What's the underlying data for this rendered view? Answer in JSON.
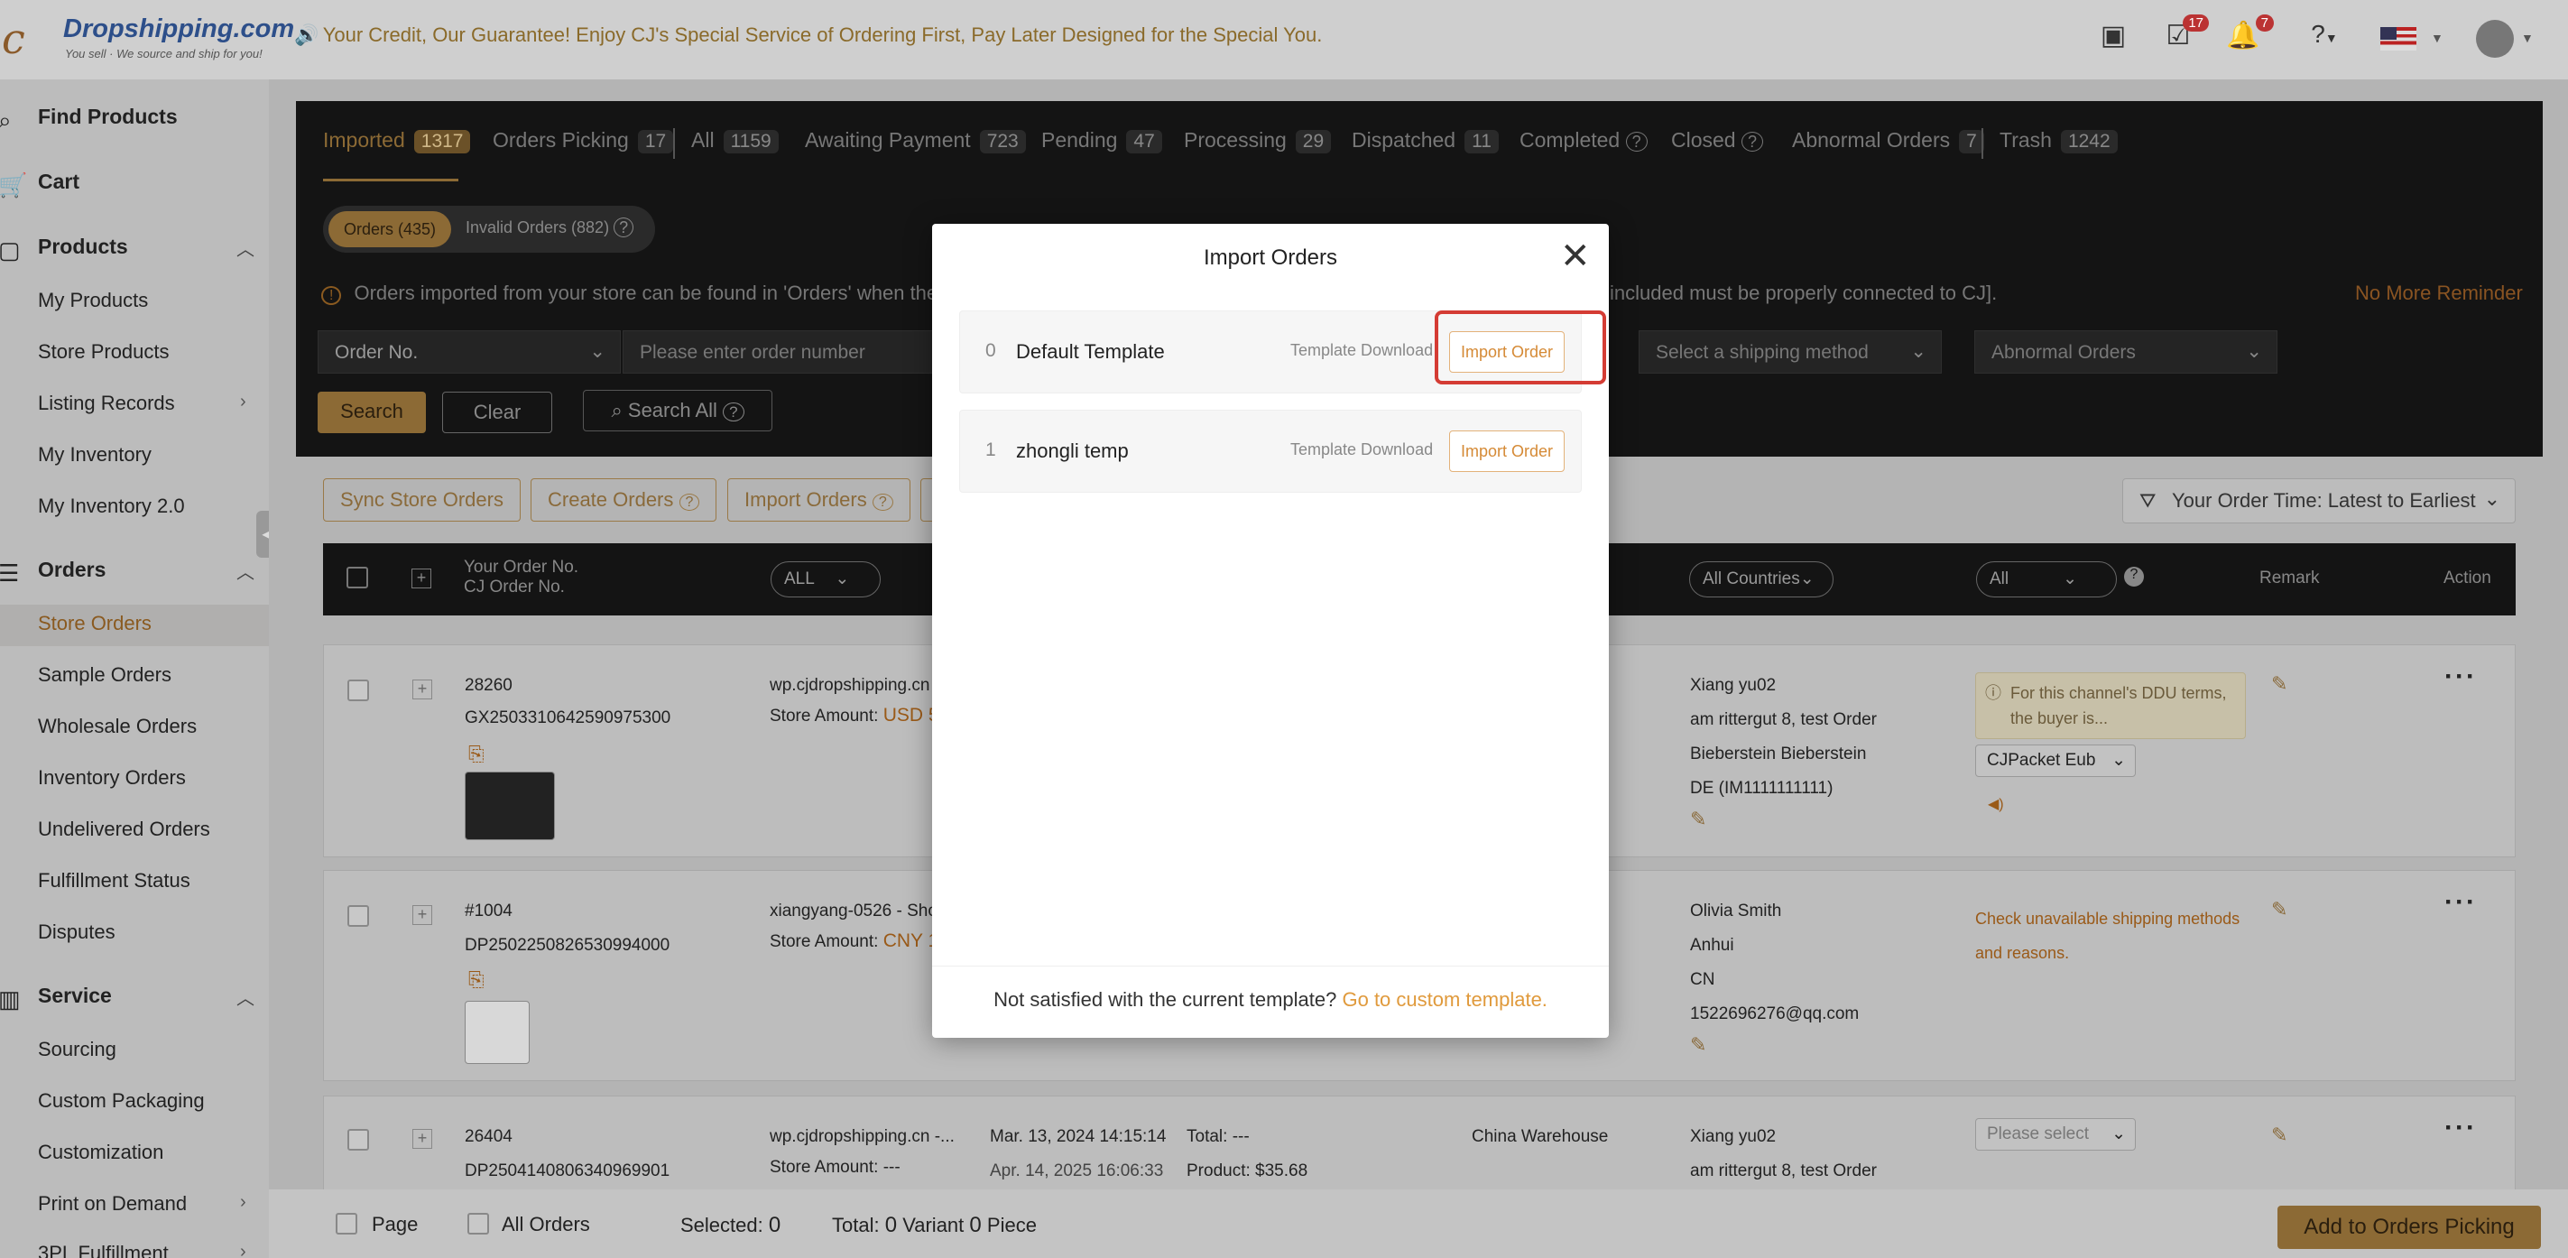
{
  "header": {
    "logo_brand": "Dropshipping.com",
    "logo_tagline": "You sell · We source and ship for you!",
    "promo_text": "Your Credit, Our Guarantee! Enjoy CJ's Special Service of Ordering First, Pay Later Designed for the Special You.",
    "tasks_badge": "17",
    "notif_badge": "7",
    "icons": [
      "video-icon",
      "tasks-icon",
      "bell-icon",
      "help-icon",
      "us-flag-icon",
      "avatar"
    ]
  },
  "sidebar": {
    "find_products": "Find Products",
    "cart": "Cart",
    "products": "Products",
    "products_items": [
      "My Products",
      "Store Products",
      "Listing Records",
      "My Inventory",
      "My Inventory 2.0"
    ],
    "orders": "Orders",
    "orders_items": [
      "Store Orders",
      "Sample Orders",
      "Wholesale Orders",
      "Inventory Orders",
      "Undelivered Orders",
      "Fulfillment Status",
      "Disputes"
    ],
    "service": "Service",
    "service_items": [
      "Sourcing",
      "Custom Packaging",
      "Customization",
      "Print on Demand",
      "3PL Fulfillment"
    ]
  },
  "tabs": [
    {
      "label": "Imported",
      "count": "1317"
    },
    {
      "label": "Orders Picking",
      "count": "17"
    },
    {
      "label": "All",
      "count": "1159"
    },
    {
      "label": "Awaiting Payment",
      "count": "723"
    },
    {
      "label": "Pending",
      "count": "47"
    },
    {
      "label": "Processing",
      "count": "29"
    },
    {
      "label": "Dispatched",
      "count": "11"
    },
    {
      "label": "Completed",
      "count": ""
    },
    {
      "label": "Closed",
      "count": ""
    },
    {
      "label": "Abnormal Orders",
      "count": "7"
    },
    {
      "label": "Trash",
      "count": "1242"
    }
  ],
  "subtabs": {
    "orders": "Orders (435)",
    "invalid": "Invalid Orders (882)"
  },
  "notice": {
    "text_left": "Orders imported from your store can be found in 'Orders' when they",
    "text_right": "included must be properly connected to CJ].",
    "no_more": "No More Reminder"
  },
  "filters": {
    "order_no": "Order No.",
    "order_placeholder": "Please enter order number",
    "shipping": "Select a shipping method",
    "abnormal": "Abnormal Orders",
    "search": "Search",
    "clear": "Clear",
    "search_all": "Search All"
  },
  "actions": {
    "sync": "Sync Store Orders",
    "create": "Create Orders",
    "import": "Import Orders",
    "sort": "Your Order Time: Latest to Earliest"
  },
  "table_head": {
    "your_order": "Your Order No.",
    "cj_order": "CJ Order No.",
    "all": "ALL",
    "countries": "All Countries",
    "all2": "All",
    "remark": "Remark",
    "action": "Action"
  },
  "rows": [
    {
      "order_no": "28260",
      "cj_no": "GX2503310642590975300",
      "store": "wp.cjdropshipping.cn -",
      "amount_label": "Store Amount:",
      "amount": "USD 5",
      "name": "Xiang yu02",
      "addr1": "am rittergut 8, test Order",
      "addr2": "Bieberstein Bieberstein",
      "addr3": "DE (IM1111111111)",
      "warn": "For this channel's DDU terms, the buyer is...",
      "ship": "CJPacket Eub"
    },
    {
      "order_no": "#1004",
      "cj_no": "DP2502250826530994000",
      "store": "xiangyang-0526 - Shop",
      "amount_label": "Store Amount:",
      "amount": "CNY 1",
      "name": "Olivia Smith",
      "addr1": "Anhui",
      "addr2": "CN",
      "addr3": "1522696276@qq.com",
      "check": "Check unavailable shipping methods and reasons."
    },
    {
      "order_no": "26404",
      "cj_no": "DP2504140806340969901",
      "store": "wp.cjdropshipping.cn -...",
      "amount_label": "Store Amount:",
      "amount": "---",
      "date1": "Mar. 13, 2024 14:15:14",
      "date2": "Apr. 14, 2025 16:06:33",
      "total": "Total: ---",
      "product": "Product: $35.68",
      "warehouse": "China Warehouse",
      "name": "Xiang yu02",
      "addr1": "am rittergut 8, test Order",
      "ship": "Please select"
    }
  ],
  "footer": {
    "page": "Page",
    "all_orders": "All Orders",
    "selected_label": "Selected:",
    "selected": "0",
    "total_label": "Total:",
    "total": "0",
    "variant": "Variant",
    "variant_n": "0",
    "piece": "Piece",
    "add_btn": "Add to Orders Picking"
  },
  "modal": {
    "title": "Import Orders",
    "templates": [
      {
        "idx": "0",
        "name": "Default Template",
        "download": "Template Download",
        "import": "Import Order"
      },
      {
        "idx": "1",
        "name": "zhongli temp",
        "download": "Template Download",
        "import": "Import Order"
      }
    ],
    "footer_text": "Not satisfied with the current template?",
    "footer_link": "Go to custom template."
  },
  "colors": {
    "accent": "#d58a36",
    "highlight": "#d43c34",
    "dark": "#141414"
  }
}
